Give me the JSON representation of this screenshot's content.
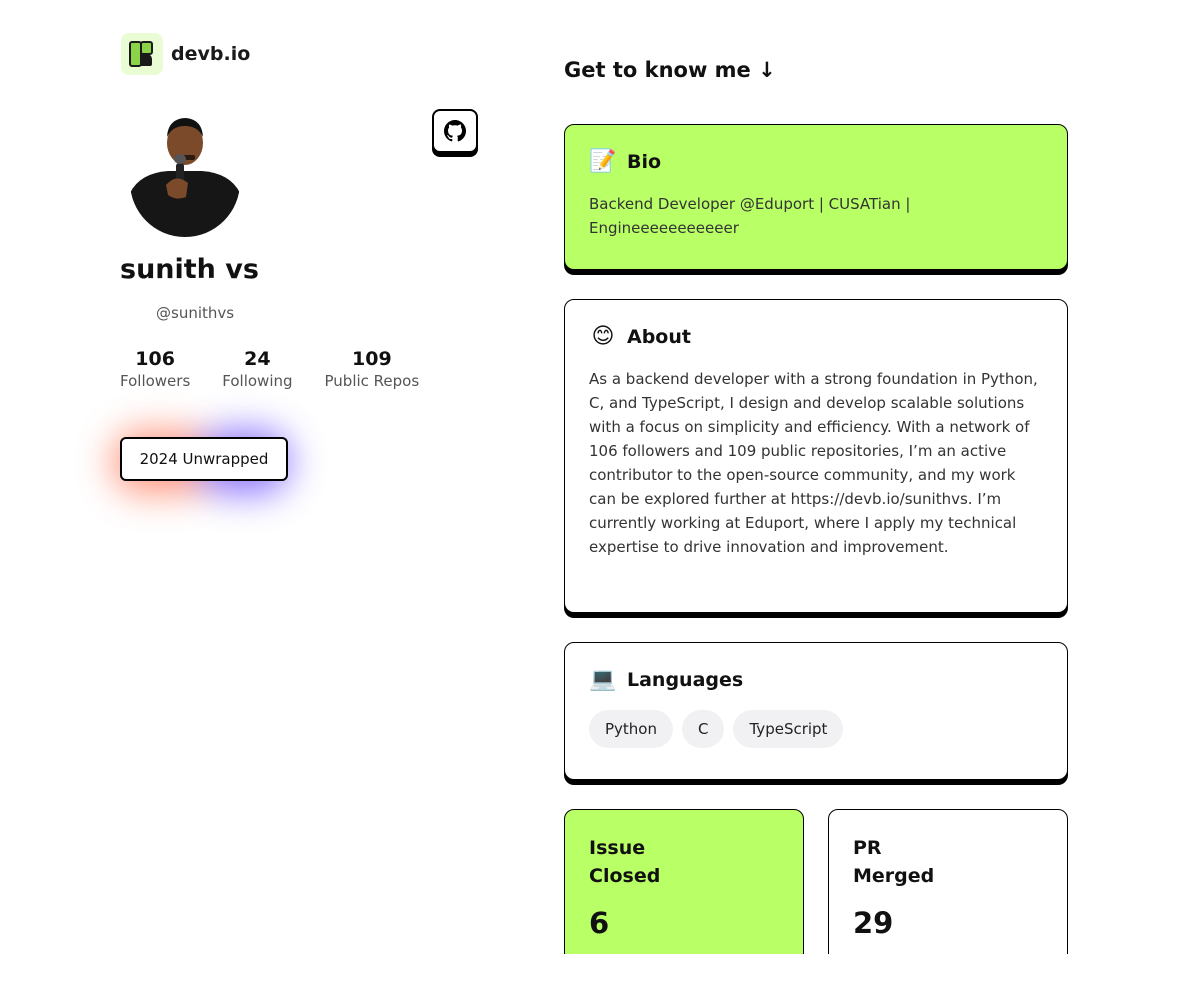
{
  "brand": {
    "name": "devb.io",
    "logo_icon": "devb-logo-icon"
  },
  "profile": {
    "name": "sunith vs",
    "username": "@sunithvs",
    "stats": [
      {
        "value": "106",
        "label": "Followers"
      },
      {
        "value": "24",
        "label": "Following"
      },
      {
        "value": "109",
        "label": "Public Repos"
      }
    ],
    "wrapped_button": "2024 Unwrapped"
  },
  "main": {
    "heading": "Get to know me ↓",
    "bio": {
      "emoji": "📝",
      "title": "Bio",
      "text": "Backend Developer @Eduport | CUSATian | Engineeeeeeeeeeer"
    },
    "about": {
      "emoji": "😊",
      "title": "About",
      "text": "As a backend developer with a strong foundation in Python, C, and TypeScript, I design and develop scalable solutions with a focus on simplicity and efficiency. With a network of 106 followers and 109 public repositories, I’m an active contributor to the open-source community, and my work can be explored further at https://devb.io/sunithvs. I’m currently working at Eduport, where I apply my technical expertise to drive innovation and improvement."
    },
    "languages": {
      "emoji": "💻",
      "title": "Languages",
      "items": [
        "Python",
        "C",
        "TypeScript"
      ]
    },
    "stat_cards": [
      {
        "label": "Issue Closed",
        "value": "6"
      },
      {
        "label": "PR Merged",
        "value": "29"
      }
    ]
  },
  "colors": {
    "accent": "#b9ff66",
    "border": "#000000",
    "glow_left": "#ff7a5c",
    "glow_right": "#6a4bff"
  }
}
